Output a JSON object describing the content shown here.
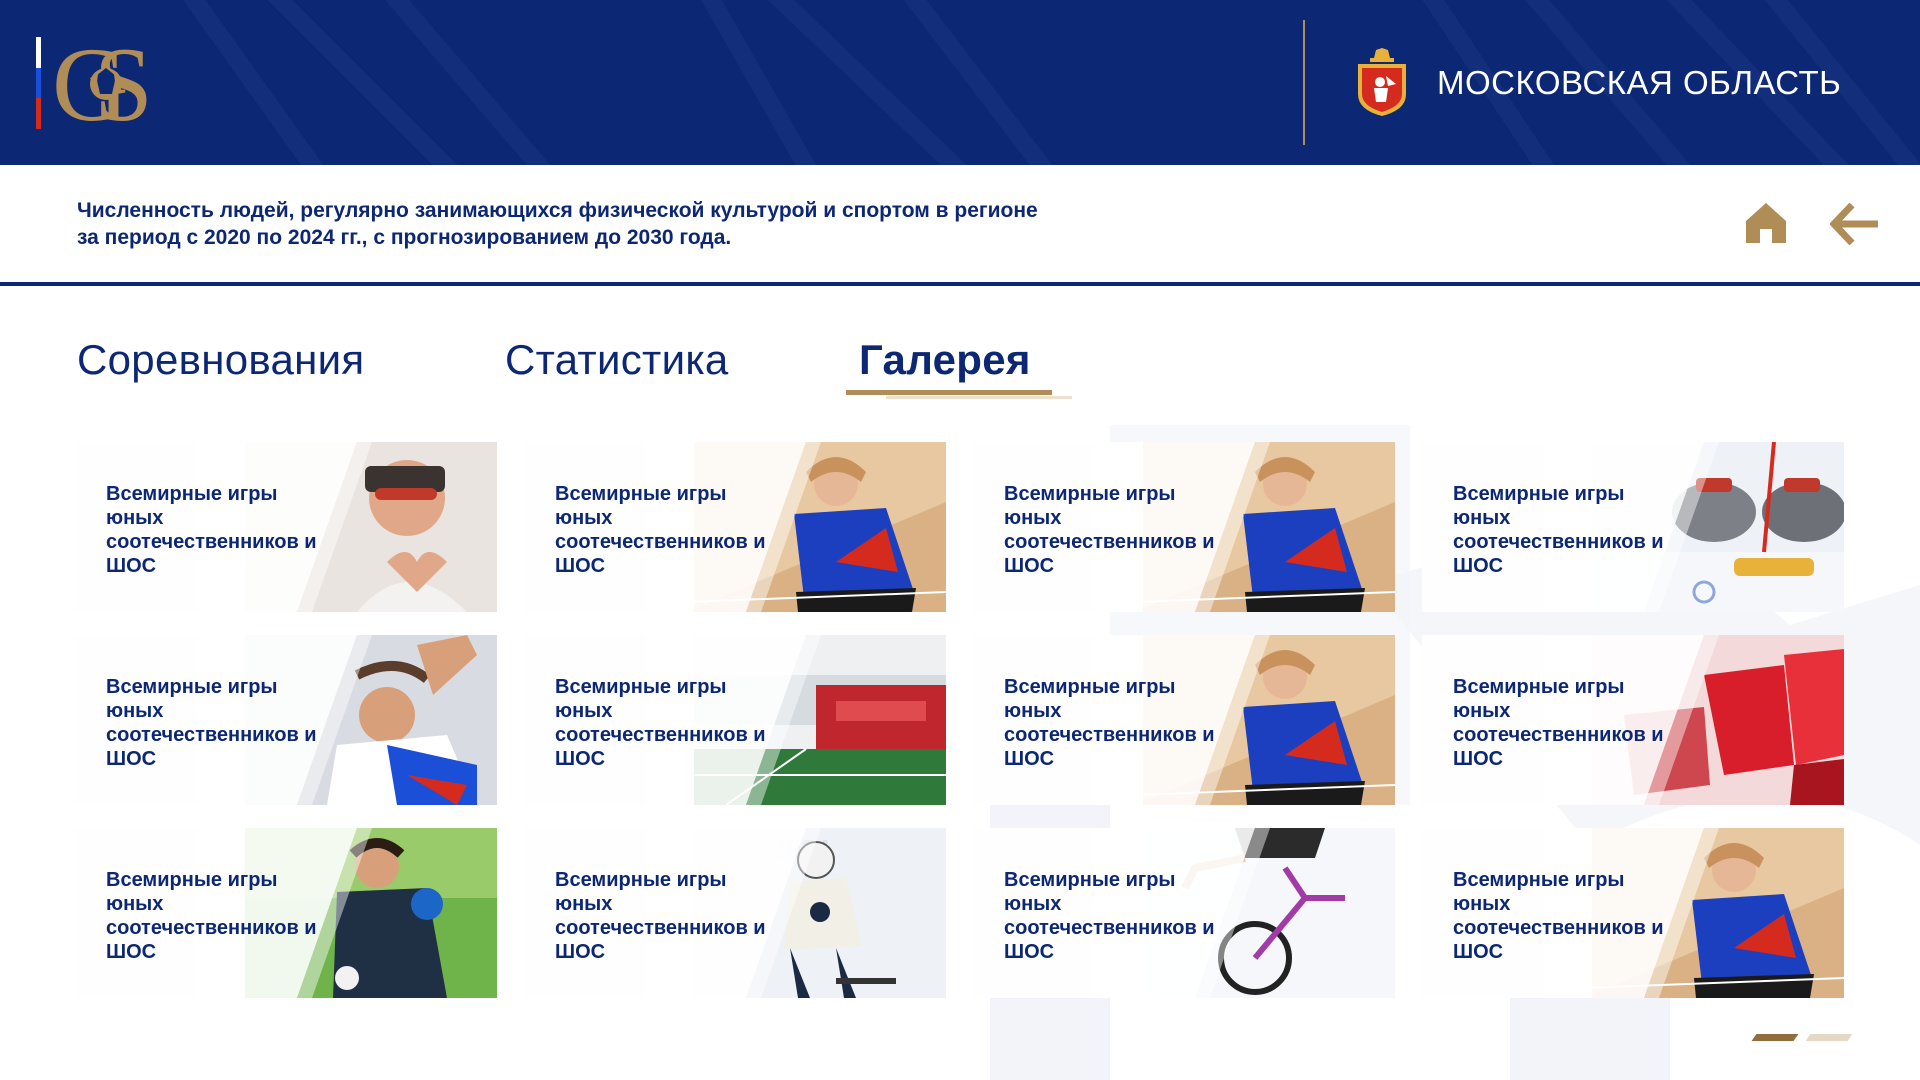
{
  "header": {
    "region_title": "МОСКОВСКАЯ ОБЛАСТЬ",
    "brand_color": "#0c2773",
    "accent_color": "#b08d57",
    "flag_colors": [
      "#ffffff",
      "#1c4fd8",
      "#d52b1e"
    ]
  },
  "subheader": {
    "title_line1": "Численность людей, регулярно занимающихся физической культурой и спортом в регионе",
    "title_line2": "за период с 2020 по 2024 гг., с прогнозированием до 2030 года.",
    "home_icon": "home-icon",
    "back_icon": "arrow-left-icon"
  },
  "tabs": [
    {
      "label": "Соревнования",
      "active": false
    },
    {
      "label": "Статистика",
      "active": false
    },
    {
      "label": "Галерея",
      "active": true
    }
  ],
  "gallery": {
    "items": [
      {
        "caption": "Всемирные игры юных соотечественников и ШОС",
        "photo": "smiling-woman-heart-hands"
      },
      {
        "caption": "Всемирные игры юных соотечественников и ШОС",
        "photo": "girl-badminton-player"
      },
      {
        "caption": "Всемирные игры юных соотечественников и ШОС",
        "photo": "girl-badminton-player"
      },
      {
        "caption": "Всемирные игры юных соотечественников и ШОС",
        "photo": "curling-stones"
      },
      {
        "caption": "Всемирные игры юных соотечественников и ШОС",
        "photo": "man-throwing-ball"
      },
      {
        "caption": "Всемирные игры юных соотечественников и ШОС",
        "photo": "stadium-red-stands"
      },
      {
        "caption": "Всемирные игры юных соотечественников и ШОС",
        "photo": "girl-badminton-player"
      },
      {
        "caption": "Всемирные игры юных соотечественников и ШОС",
        "photo": "red-stadium-seats"
      },
      {
        "caption": "Всемирные игры юных соотечественников и ШОС",
        "photo": "football-goalkeeper"
      },
      {
        "caption": "Всемирные игры юных соотечественников и ШОС",
        "photo": "hockey-player"
      },
      {
        "caption": "Всемирные игры юных соотечественников и ШОС",
        "photo": "bmx-rider"
      },
      {
        "caption": "Всемирные игры юных соотечественников и ШОС",
        "photo": "girl-badminton-player"
      }
    ]
  },
  "pager": {
    "pages": 2,
    "current": 1
  }
}
